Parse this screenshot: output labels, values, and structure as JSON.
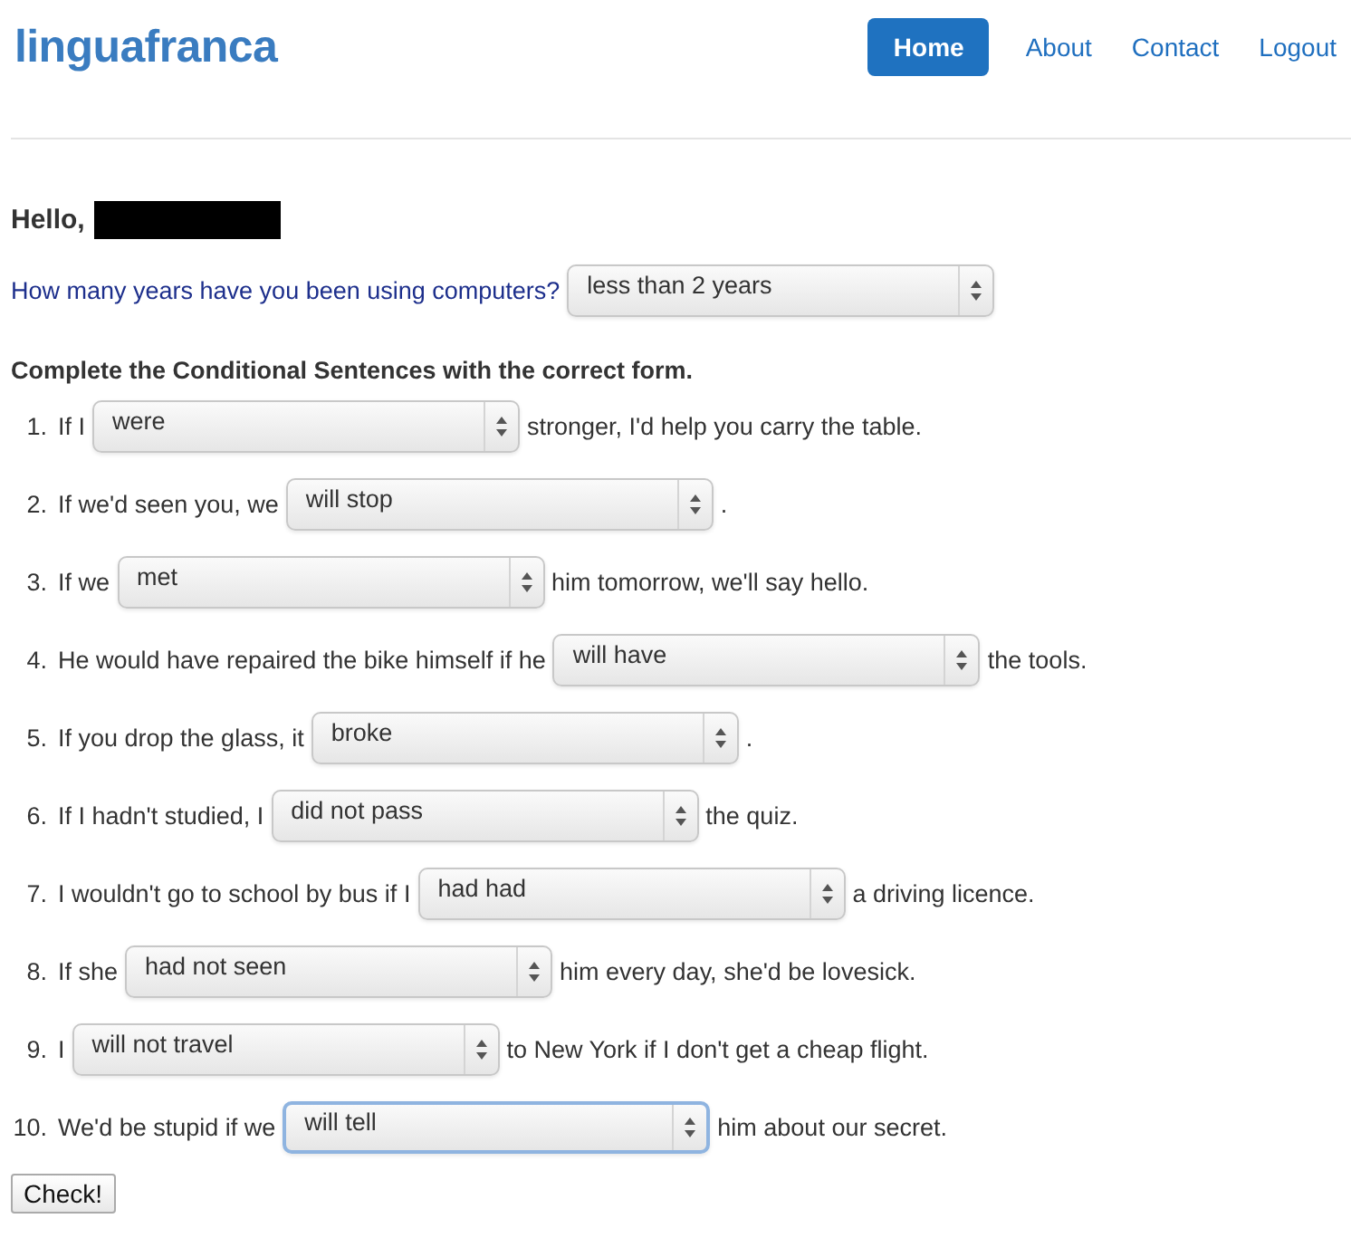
{
  "header": {
    "logo": "linguafranca",
    "nav": [
      {
        "label": "Home",
        "selected": true
      },
      {
        "label": "About",
        "selected": false
      },
      {
        "label": "Contact",
        "selected": false
      },
      {
        "label": "Logout",
        "selected": false
      }
    ]
  },
  "greeting": "Hello,",
  "question": {
    "label": "How many years have you been using computers?",
    "value": "less than 2 years"
  },
  "instruction": "Complete the Conditional Sentences with the correct form.",
  "items": [
    {
      "number": "1.",
      "before": "If I",
      "value": "were",
      "after": "stronger, I'd help you carry the table.",
      "focused": false
    },
    {
      "number": "2.",
      "before": "If we'd seen you, we",
      "value": "will stop",
      "after": ".",
      "focused": false
    },
    {
      "number": "3.",
      "before": "If we",
      "value": "met",
      "after": "him tomorrow, we'll say hello.",
      "focused": false
    },
    {
      "number": "4.",
      "before": "He would have repaired the bike himself if he",
      "value": "will have",
      "after": "the tools.",
      "focused": false
    },
    {
      "number": "5.",
      "before": "If you drop the glass, it",
      "value": "broke",
      "after": ".",
      "focused": false
    },
    {
      "number": "6.",
      "before": "If I hadn't studied, I",
      "value": "did not pass",
      "after": "the quiz.",
      "focused": false
    },
    {
      "number": "7.",
      "before": "I wouldn't go to school by bus if I",
      "value": "had had",
      "after": "a driving licence.",
      "focused": false
    },
    {
      "number": "8.",
      "before": "If she",
      "value": "had not seen",
      "after": "him every day, she'd be lovesick.",
      "focused": false
    },
    {
      "number": "9.",
      "before": "I",
      "value": "will not travel",
      "after": "to New York if I don't get a cheap flight.",
      "focused": false
    },
    {
      "number": "10.",
      "before": "We'd be stupid if we",
      "value": "will tell",
      "after": "him about our secret.",
      "focused": true
    }
  ],
  "submit": "Check!"
}
